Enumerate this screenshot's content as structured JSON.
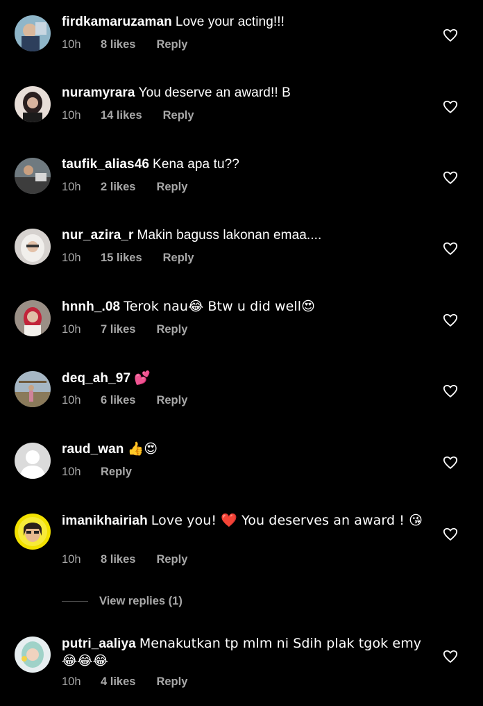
{
  "comments": [
    {
      "username": "firdkamaruzaman",
      "text": "Love your acting!!!",
      "time": "10h",
      "likes": "8 likes",
      "reply": "Reply"
    },
    {
      "username": "nuramyrara",
      "text": "You deserve an award!! B",
      "time": "10h",
      "likes": "14 likes",
      "reply": "Reply"
    },
    {
      "username": "taufik_alias46",
      "text": "Kena apa tu??",
      "time": "10h",
      "likes": "2 likes",
      "reply": "Reply"
    },
    {
      "username": "nur_azira_r",
      "text": "Makin baguss lakonan emaa....",
      "time": "10h",
      "likes": "15 likes",
      "reply": "Reply"
    },
    {
      "username": "hnnh_.08",
      "text": "Terok nau😂 Btw u did well😍",
      "time": "10h",
      "likes": "7 likes",
      "reply": "Reply"
    },
    {
      "username": "deq_ah_97",
      "text": "💕",
      "time": "10h",
      "likes": "6 likes",
      "reply": "Reply"
    },
    {
      "username": "raud_wan",
      "text": "👍😍",
      "time": "10h",
      "likes": "",
      "reply": "Reply"
    },
    {
      "username": "imanikhairiah",
      "text": "Love you! ❤️ You deserves an award ! 😘",
      "time": "10h",
      "likes": "8 likes",
      "reply": "Reply"
    },
    {
      "username": "putri_aaliya",
      "text": "Menakutkan tp mlm ni Sdih plak tgok emy 😂😂😂",
      "time": "10h",
      "likes": "4 likes",
      "reply": "Reply"
    }
  ],
  "view_replies": "View replies (1)",
  "colors": {
    "background": "#000000",
    "text": "#ffffff",
    "secondary": "#a8a8a8",
    "heart_red": "#e0243a"
  },
  "icons": {
    "like": "heart-outline-icon",
    "avatar_placeholder": "default-avatar-icon"
  }
}
